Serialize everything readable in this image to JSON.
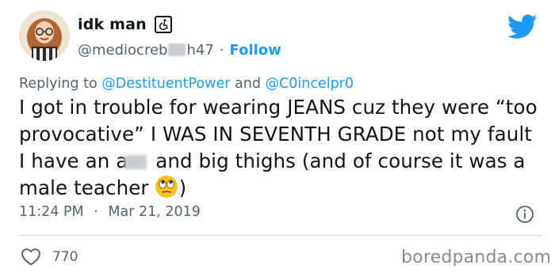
{
  "tweet": {
    "author": {
      "display_name": "idk man",
      "accessibility_icon": "wheelchair-icon",
      "handle_start": "@mediocreb",
      "handle_end": "h47",
      "avatar": "avatar"
    },
    "separator": "·",
    "follow_label": "Follow",
    "reply": {
      "prefix": "Replying to",
      "mention1": "@DestituentPower",
      "conjunction": "and",
      "mention2": "@C0incelpr0"
    },
    "text": {
      "part1": "I got in trouble for wearing JEANS cuz they were “too provocative” I WAS IN SEVENTH GRADE not my fault I have an a",
      "part2": " and big thighs (and of course it was a male teacher",
      "emoji": "rolling-eyes-emoji",
      "part3": ")"
    },
    "time": "11:24 PM",
    "date": "Mar 21, 2019",
    "likes_count": "770"
  },
  "icons": {
    "brand": "twitter-bird-icon",
    "info": "info-icon",
    "like": "heart-icon"
  },
  "colors": {
    "accent": "#1d9bf0",
    "secondary_text": "#536471",
    "divider": "#cfd9de"
  },
  "watermark": "boredpanda.com"
}
